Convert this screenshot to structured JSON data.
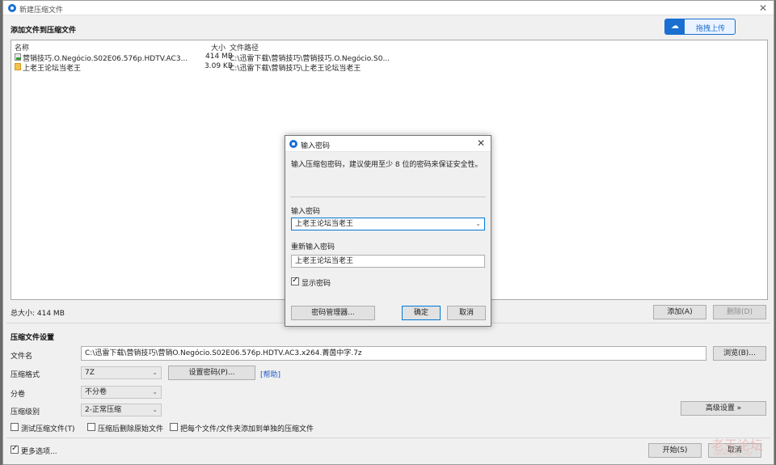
{
  "window": {
    "title": "新建压缩文件",
    "close": "✕"
  },
  "upload": {
    "label": "拖拽上传",
    "icon": "cloud-icon"
  },
  "filelist": {
    "heading": "添加文件到压缩文件",
    "columns": {
      "name": "名称",
      "size": "大小",
      "path": "文件路径"
    },
    "rows": [
      {
        "name": "营销技巧.O.Negócio.S02E06.576p.HDTV.AC3...",
        "size": "414 MB",
        "path": "C:\\迅雷下载\\营销技巧\\营销技巧.O.Negócio.S0...",
        "icon": "video-file-icon"
      },
      {
        "name": "上老王论坛当老王",
        "size": "3.09 KB",
        "path": "C:\\迅雷下载\\营销技巧\\上老王论坛当老王",
        "icon": "folder-icon"
      }
    ],
    "total": "总大小: 414 MB",
    "add": "添加(A)",
    "delete": "删除(D)"
  },
  "settings": {
    "heading": "压缩文件设置",
    "filename_label": "文件名",
    "filename_value": "C:\\迅雷下载\\营销技巧\\营销O.Negócio.S02E06.576p.HDTV.AC3.x264.菁茵中字.7z",
    "browse": "浏览(B)...",
    "format_label": "压缩格式",
    "format_value": "7Z",
    "set_password": "设置密码(P)...",
    "help": "[帮助]",
    "split_label": "分卷",
    "split_value": "不分卷",
    "level_label": "压缩级别",
    "level_value": "2-正常压缩",
    "advanced": "高级设置 »",
    "test_label": "测试压缩文件(T)",
    "delete_after_label": "压缩后删除原始文件",
    "separate_label": "把每个文件/文件夹添加到单独的压缩文件",
    "more_options": "更多选项...",
    "start": "开始(S)",
    "cancel": "取消"
  },
  "dialog": {
    "title": "输入密码",
    "close": "✕",
    "hint": "输入压缩包密码，建议使用至少 8 位的密码来保证安全性。",
    "password_label": "输入密码",
    "password_value": "上老王论坛当老王",
    "confirm_label": "重新输入密码",
    "confirm_value": "上老王论坛当老王",
    "show_password": "显示密码",
    "manager": "密码管理器...",
    "ok": "确定",
    "cancel": "取消"
  },
  "watermark": {
    "main": "老王论坛",
    "sub": "laowang.vip"
  }
}
